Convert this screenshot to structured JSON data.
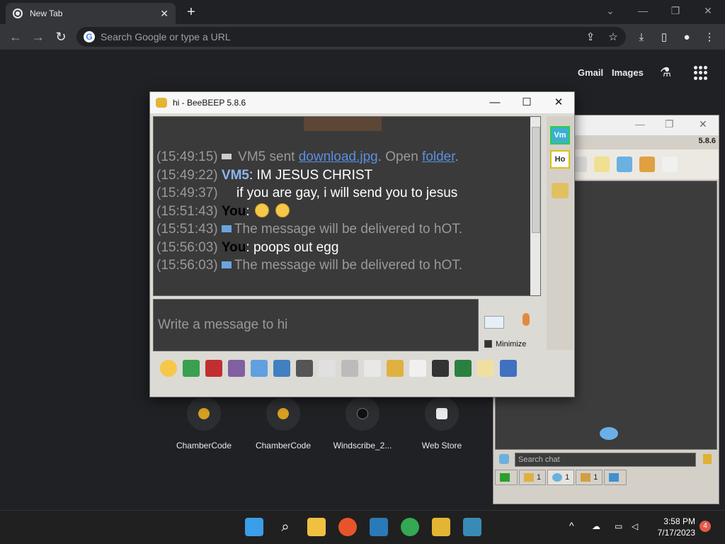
{
  "browser": {
    "tab_title": "New Tab",
    "omnibox_placeholder": "Search Google or type a URL",
    "ntp_links": [
      "Gmail",
      "Images"
    ],
    "shortcuts": [
      {
        "label": "ChamberCode",
        "color": "#d8a020"
      },
      {
        "label": "ChamberCode",
        "color": "#d8a020"
      },
      {
        "label": "Windscribe_2...",
        "color": "#333333"
      },
      {
        "label": "Web Store",
        "color": "#e8eaed"
      }
    ]
  },
  "chat_window": {
    "title": "hi - BeeBEEP 5.8.6",
    "input_placeholder": "Write a message to hi",
    "minimize_label": "Minimize",
    "sidebar": {
      "vm": "Vm",
      "ho": "Ho"
    },
    "messages": [
      {
        "time": "(15:49:15)",
        "type": "file",
        "text_before": " VM5 sent ",
        "link1": "download.jpg",
        "text_mid": ". Open ",
        "link2": "folder",
        "text_after": "."
      },
      {
        "time": "(15:49:22)",
        "type": "msg",
        "sender": "VM5",
        "body": ": IM JESUS CHRIST"
      },
      {
        "time": "(15:49:37)",
        "type": "cont",
        "body": "    if you are gay, i will send you to jesus"
      },
      {
        "time": "(15:51:43)",
        "type": "emoji",
        "sender": "You",
        "body": ":"
      },
      {
        "time": "(15:51:43)",
        "type": "sys",
        "body": "The message will be delivered to hOT."
      },
      {
        "time": "(15:56:03)",
        "type": "msg",
        "sender": "You",
        "body": ": poops out egg"
      },
      {
        "time": "(15:56:03)",
        "type": "sys",
        "body": "The message will be delivered to hOT."
      }
    ]
  },
  "main_window": {
    "version": "5.8.6",
    "search_placeholder": "Search chat",
    "tabs": [
      {
        "icon": "monitor-icon",
        "count": ""
      },
      {
        "icon": "users-icon",
        "count": "1"
      },
      {
        "icon": "chat-icon",
        "count": "1"
      },
      {
        "icon": "group-icon",
        "count": "1"
      },
      {
        "icon": "share-icon",
        "count": ""
      }
    ]
  },
  "taskbar": {
    "time": "3:58 PM",
    "date": "7/17/2023",
    "notifications": "4"
  },
  "colors": {
    "chrome_bg": "#202124",
    "chat_bg": "#3a3a3a",
    "link": "#5a8ee0",
    "vm5": "#8cb4f0"
  }
}
